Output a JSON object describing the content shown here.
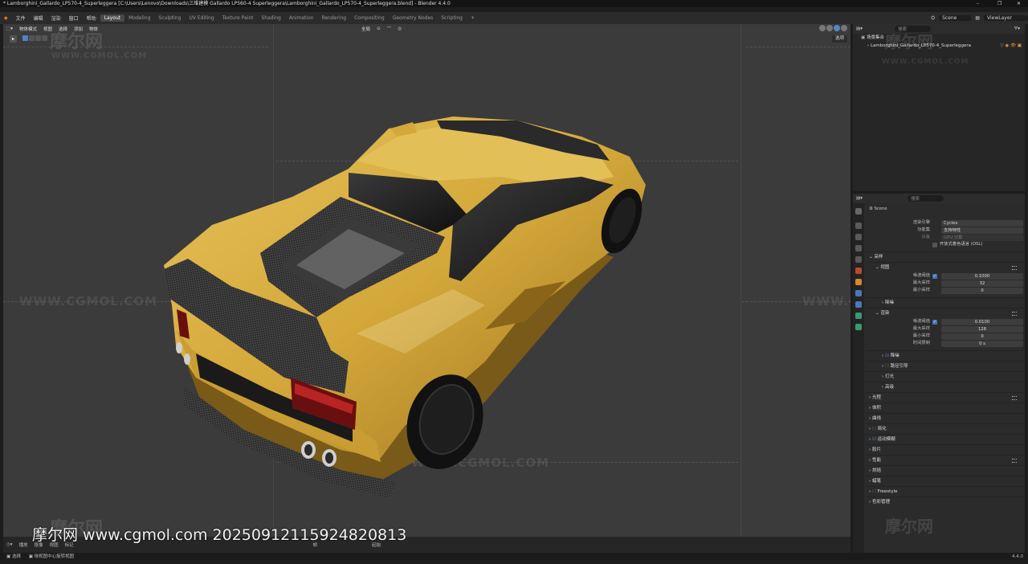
{
  "title": "* Lamborghini_Gallardo_LP570-4_Superleggera [C:\\Users\\Lenovo\\Downloads\\三维建模 Gallardo LP560-4 Superleggera\\Lamborghini_Gallardo_LP570-4_Superleggera.blend] - Blender 4.4.0",
  "window_controls": [
    "–",
    "❐",
    "✕"
  ],
  "menu": [
    "文件",
    "编辑",
    "渲染",
    "窗口",
    "帮助"
  ],
  "workspaces": [
    "Layout",
    "Modeling",
    "Sculpting",
    "UV Editing",
    "Texture Paint",
    "Shading",
    "Animation",
    "Rendering",
    "Compositing",
    "Geometry Nodes",
    "Scripting",
    "+"
  ],
  "scene_name": "Scene",
  "view_layer": "ViewLayer",
  "viewport_header": {
    "mode": "物体模式",
    "menus": [
      "视图",
      "选择",
      "添加",
      "物体"
    ],
    "orientation": "全局",
    "view_button": "选项"
  },
  "outliner": {
    "search_placeholder": "搜索",
    "root": "场景集合",
    "item": "Lamborghini_Gallardo_LP570-4_Superleggera"
  },
  "properties": {
    "search_placeholder": "搜索",
    "breadcrumb": "Scene",
    "render_engine_label": "渲染引擎",
    "render_engine": "Cycles",
    "feature_set_label": "功能集",
    "feature_set": "支持特性",
    "device_label": "设备",
    "device": "GPU 计算",
    "osl_label": "开放式着色语言 (OSL)",
    "sampling": "采样",
    "viewport": "视图",
    "noise_threshold_label": "噪波阈值",
    "vp_noise_threshold": "0.1000",
    "max_samples_label": "最大采样",
    "vp_max_samples": "32",
    "min_samples_label": "最小采样",
    "vp_min_samples": "0",
    "denoise": "降噪",
    "render": "渲染",
    "r_noise_threshold": "0.0100",
    "r_max_samples": "128",
    "r_min_samples": "0",
    "time_limit_label": "时间限制",
    "r_time_limit": "0 s",
    "r_denoise": "降噪",
    "path_guiding": "路径引导",
    "lights": "灯光",
    "advanced": "高级",
    "sections": [
      "光程",
      "体积",
      "曲线",
      "简化",
      "运动模糊",
      "胶片",
      "性能",
      "烘焙",
      "蜡笔",
      "Freestyle",
      "色彩管理"
    ]
  },
  "timeline": {
    "playback": "播放",
    "keying": "抠像",
    "view": "视图",
    "marker": "标记",
    "frame_label": "帧",
    "start_label": "起始"
  },
  "statusbar": {
    "select": "选择",
    "center": "绕视图中心旋转视图",
    "version": "4.4.0"
  },
  "watermark_text": "摩尔网 www.cgmol.com 20250912115924820813",
  "bg_watermark_cn": "摩尔网",
  "bg_watermark_en": "WWW.CGMOL.COM"
}
